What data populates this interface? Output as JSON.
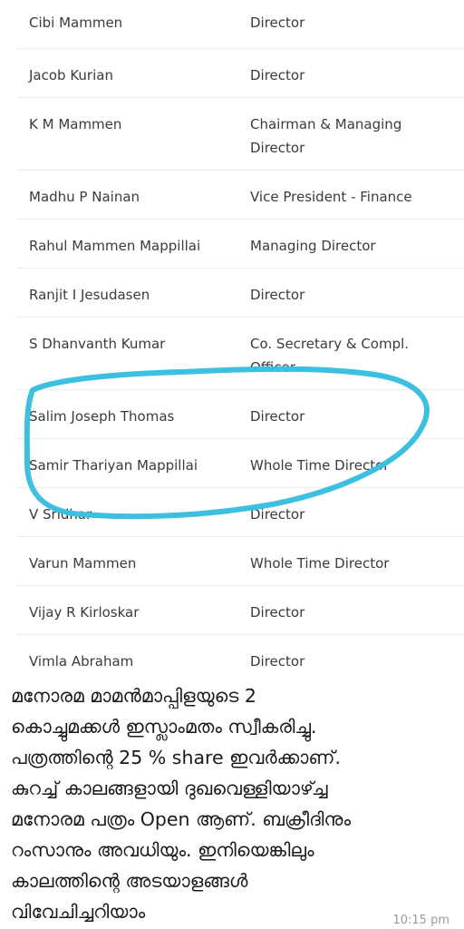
{
  "board": {
    "rows": [
      {
        "name": "Cibi Mammen",
        "role": "Director"
      },
      {
        "name": "Jacob Kurian",
        "role": "Director"
      },
      {
        "name": "K M Mammen",
        "role": "Chairman & Managing Director"
      },
      {
        "name": "Madhu P Nainan",
        "role": "Vice President - Finance"
      },
      {
        "name": "Rahul Mammen Mappillai",
        "role": "Managing Director"
      },
      {
        "name": "Ranjit I Jesudasen",
        "role": "Director"
      },
      {
        "name": "S Dhanvanth Kumar",
        "role": "Co. Secretary & Compl. Officer"
      },
      {
        "name": "Salim Joseph Thomas",
        "role": "Director"
      },
      {
        "name": "Samir Thariyan Mappillai",
        "role": "Whole Time Director"
      },
      {
        "name": "V Sridhar",
        "role": "Director"
      },
      {
        "name": "Varun Mammen",
        "role": "Whole Time Director"
      },
      {
        "name": "Vijay R Kirloskar",
        "role": "Director"
      },
      {
        "name": "Vimla Abraham",
        "role": "Director"
      }
    ]
  },
  "annotation": {
    "stroke_color": "#3dbfe0"
  },
  "message": {
    "lines": [
      "മനോരമ മാമൻമാപ്പിളയുടെ 2",
      "കൊച്ചുമക്കൾ ഇസ്ലാംമതം സ്വീകരിച്ചു.",
      "പത്രത്തിന്റെ 25 % share ഇവർക്കാണ്.",
      "കുറച്ച് കാലങ്ങളായി ദുഖവെള്ളിയാഴ്ച്ച",
      "മനോരമ പത്രം Open ആണ്. ബക്രീദിനും",
      "റംസാനും അവധിയും. ഇനിയെങ്കിലും",
      "കാലത്തിന്റെ അടയാളങ്ങൾ",
      "വിവേചിച്ചറിയാം"
    ],
    "timestamp": "10:15 pm"
  }
}
